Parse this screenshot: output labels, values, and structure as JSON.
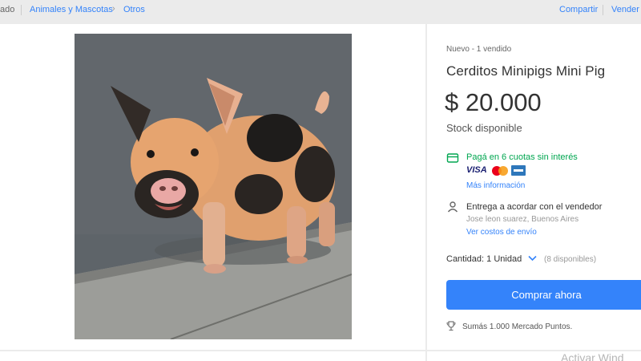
{
  "breadcrumb": {
    "cut_item": "ado",
    "items": [
      "Animales y Mascotas",
      "Otros"
    ]
  },
  "header_actions": {
    "share": "Compartir",
    "sell": "Vender"
  },
  "product": {
    "condition": "Nuevo",
    "sold": "1 vendido",
    "title": "Cerditos Minipigs Mini Pig",
    "price": "$ 20.000",
    "stock": "Stock disponible",
    "image_alt": "pig-photo"
  },
  "payment": {
    "installments": "Pagá en 6 cuotas sin interés",
    "card_brands": [
      "VISA",
      "mastercard",
      "amex"
    ],
    "more_info": "Más información"
  },
  "shipping": {
    "delivery": "Entrega a acordar con el vendedor",
    "location": "Jose leon suarez, Buenos Aires",
    "costs_link": "Ver costos de envío"
  },
  "quantity": {
    "label": "Cantidad:",
    "value": "1 Unidad",
    "available": "(8 disponibles)"
  },
  "buy_button": "Comprar ahora",
  "points": "Sumás 1.000 Mercado Puntos.",
  "watermark": "Activar Wind",
  "colors": {
    "accent": "#3483fa",
    "success": "#00a650",
    "background": "#ebebeb"
  }
}
